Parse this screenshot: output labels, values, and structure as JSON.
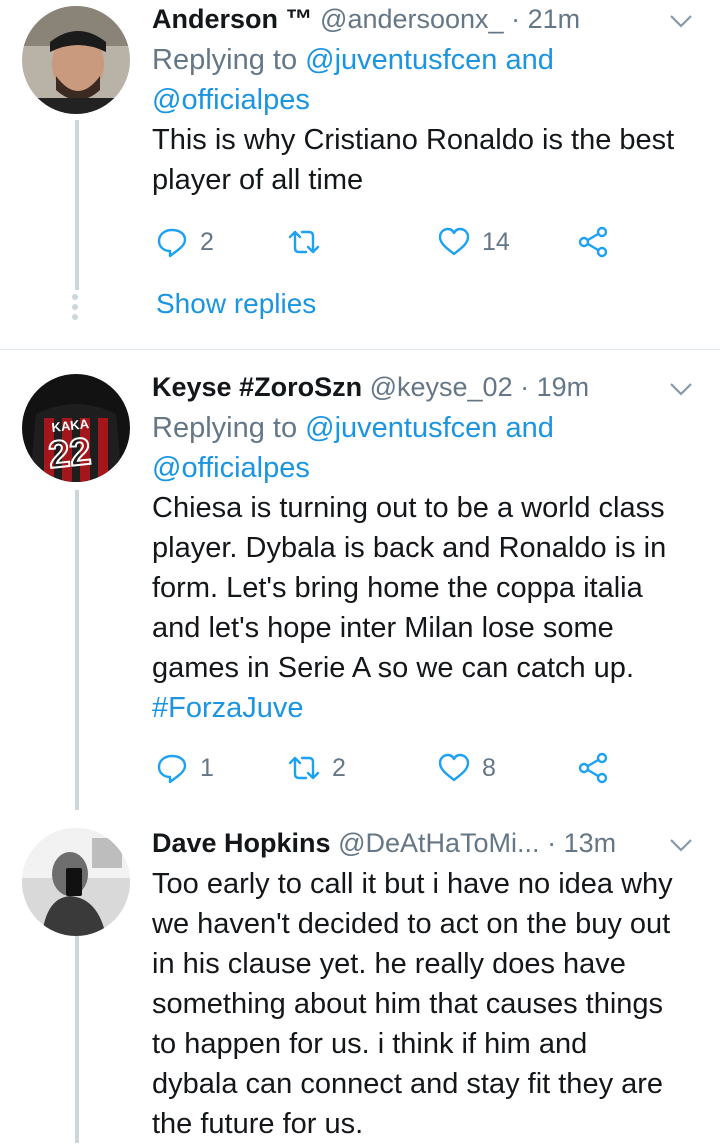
{
  "tweets": [
    {
      "name": "Anderson ™",
      "handle": "@andersoonx_",
      "separator": "·",
      "time": "21m",
      "replying_prefix": "Replying to ",
      "replying_to_1": "@juventusfcen",
      "replying_and": " and",
      "replying_to_2": "@officialpes",
      "text_lines": [
        "This is why Cristiano Ronaldo is the best",
        "player of all time"
      ],
      "replies": "2",
      "retweets": "",
      "likes": "14",
      "show_replies": "Show replies"
    },
    {
      "name": "Keyse #ZoroSzn",
      "handle": "@keyse_02",
      "separator": "·",
      "time": "19m",
      "replying_prefix": "Replying to ",
      "replying_to_1": "@juventusfcen",
      "replying_and": " and",
      "replying_to_2": "@officialpes",
      "text_lines": [
        "Chiesa is turning out to be a world class",
        "player. Dybala is back and Ronaldo is in",
        "form. Let's bring home the coppa italia",
        "and let's hope inter Milan lose some",
        "games in Serie A so we can catch up."
      ],
      "hashtag": "#ForzaJuve",
      "avatar_jersey_name": "KAKA",
      "avatar_jersey_number": "22",
      "replies": "1",
      "retweets": "2",
      "likes": "8"
    },
    {
      "name": "Dave Hopkins",
      "handle": "@DeAtHaToMi...",
      "separator": "·",
      "time": "13m",
      "text_lines": [
        "Too early to call it but i have no idea why",
        "we haven't decided to act on the buy out",
        "in his clause yet. he really does have",
        "something about him that causes things",
        "to happen for us. i think if him and",
        "dybala can connect and stay fit they are",
        "the future for us."
      ]
    }
  ],
  "colors": {
    "link": "#1b95e0",
    "muted": "#657786",
    "text": "#14171a",
    "thread_line": "#ccd6dd",
    "divider": "#e1e8ed"
  },
  "icons": [
    "reply-icon",
    "retweet-icon",
    "like-icon",
    "share-icon",
    "chevron-down-icon"
  ]
}
